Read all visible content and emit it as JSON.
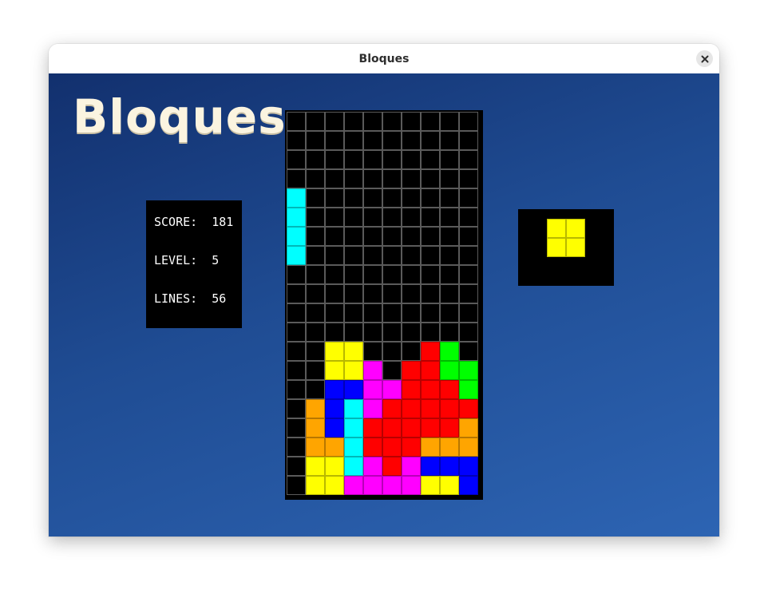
{
  "window": {
    "title": "Bloques"
  },
  "game": {
    "logo": "Bloques",
    "stats": {
      "score_label": "SCORE:",
      "score": "181",
      "level_label": "LEVEL:",
      "level": "5",
      "lines_label": "LINES:",
      "lines": "56"
    },
    "colors": {
      "Y": "#ffff00",
      "M": "#ff00ff",
      "R": "#ff0000",
      "G": "#00ff00",
      "B": "#0000ff",
      "C": "#00ffff",
      "O": "#ffa500",
      "grid": "#5a5a5a",
      "board_bg": "#000000"
    },
    "board": {
      "columns": 10,
      "rows": [
        "..........",
        "..........",
        "..........",
        "..........",
        "C.........",
        "C.........",
        "C.........",
        "C.........",
        "..........",
        "..........",
        "..........",
        "..........",
        "..YY...RG.",
        "..YYM.RRGG",
        "..BBMMRRRG",
        ".OBCMRRRRR",
        ".OBCRRRRRO",
        ".OOCRRROOO",
        ".YYCMRMBBB",
        ".YYMMMMYYB"
      ]
    },
    "next_piece": {
      "color": "Y",
      "shape": [
        "YY",
        "YY"
      ]
    }
  }
}
